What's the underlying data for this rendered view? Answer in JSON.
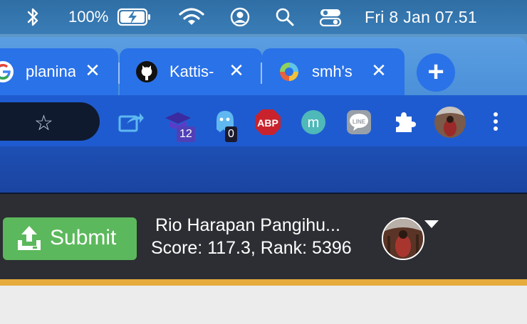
{
  "menubar": {
    "battery_pct": "100%",
    "clock": "Fri 8 Jan  07.51"
  },
  "tabs": [
    {
      "title": "planina",
      "favicon": "google-icon"
    },
    {
      "title": "Kattis-",
      "favicon": "github-icon"
    },
    {
      "title": "smh's",
      "favicon": "colorful-ring-icon"
    }
  ],
  "new_tab_label": "+",
  "tab_close_label": "✕",
  "toolbar": {
    "extensions": [
      {
        "name": "share-extension"
      },
      {
        "name": "graduation-cap-extension",
        "badge": "12"
      },
      {
        "name": "ghost-extension",
        "badge": "0"
      },
      {
        "name": "adblock-plus-extension",
        "label": "ABP"
      },
      {
        "name": "mailtrack-extension",
        "label": "m"
      },
      {
        "name": "line-extension",
        "label": "LINE"
      },
      {
        "name": "extensions-puzzle"
      },
      {
        "name": "profile-avatar"
      },
      {
        "name": "kebab-menu"
      }
    ]
  },
  "site": {
    "submit_label": "Submit",
    "user_name": "Rio Harapan Pangihu...",
    "user_score": "Score: 117.3, Rank: 5396"
  },
  "colors": {
    "submit_green": "#5cb85c",
    "header_dark": "#2d2e33",
    "accent_gold": "#e6ab3c",
    "tab_blue": "#2a72e8"
  }
}
